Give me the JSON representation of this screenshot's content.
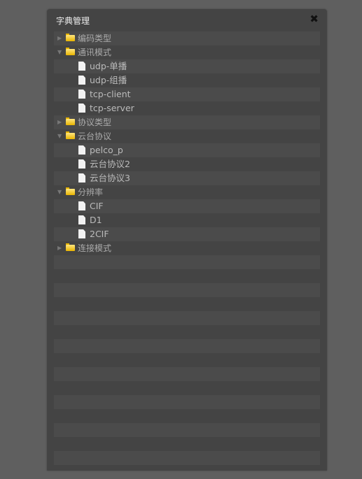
{
  "dialog": {
    "title": "字典管理",
    "close_icon": "close-icon"
  },
  "tree": [
    {
      "label": "编码类型",
      "type": "folder",
      "expanded": false
    },
    {
      "label": "通讯模式",
      "type": "folder",
      "expanded": true
    },
    {
      "label": "udp-单播",
      "type": "file"
    },
    {
      "label": "udp-组播",
      "type": "file"
    },
    {
      "label": "tcp-client",
      "type": "file"
    },
    {
      "label": "tcp-server",
      "type": "file"
    },
    {
      "label": "协议类型",
      "type": "folder",
      "expanded": false
    },
    {
      "label": "云台协议",
      "type": "folder",
      "expanded": true
    },
    {
      "label": "pelco_p",
      "type": "file"
    },
    {
      "label": "云台协议2",
      "type": "file"
    },
    {
      "label": "云台协议3",
      "type": "file"
    },
    {
      "label": "分辨率",
      "type": "folder",
      "expanded": true
    },
    {
      "label": "CIF",
      "type": "file"
    },
    {
      "label": "D1",
      "type": "file"
    },
    {
      "label": "2CIF",
      "type": "file"
    },
    {
      "label": "连接模式",
      "type": "folder",
      "expanded": false
    }
  ]
}
